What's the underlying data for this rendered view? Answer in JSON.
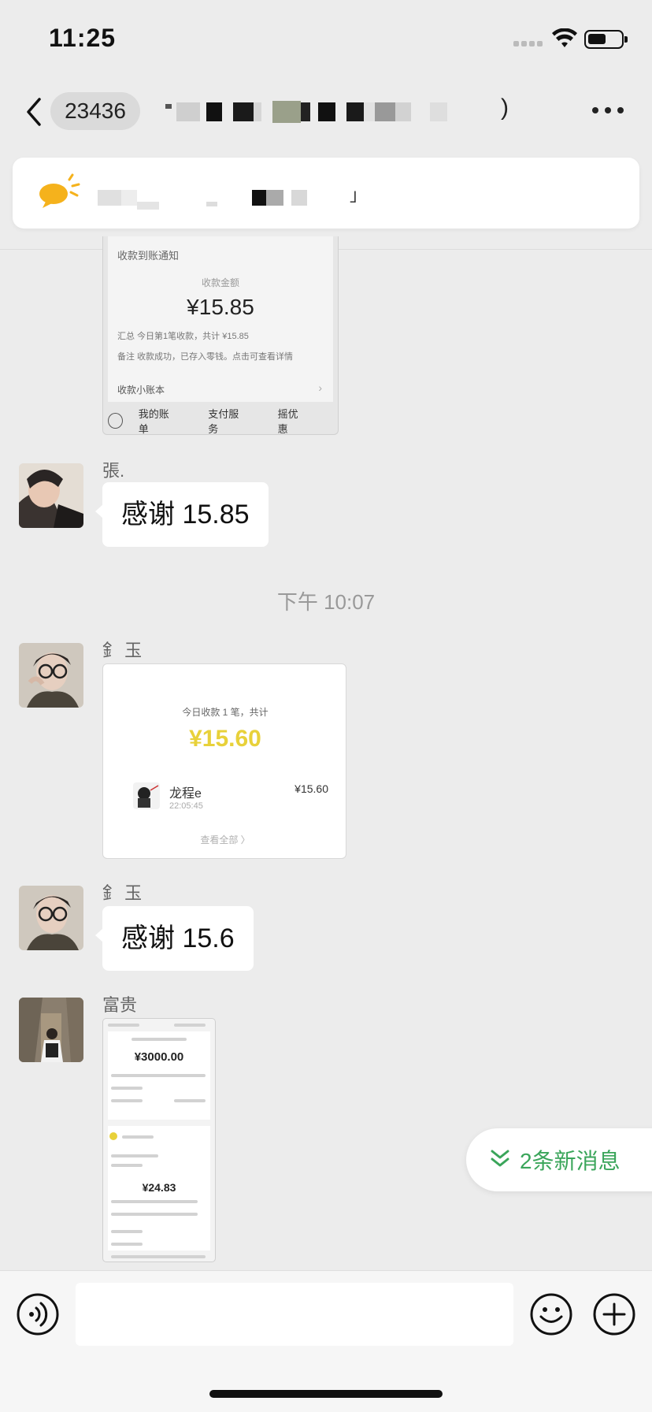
{
  "status_bar": {
    "time": "11:25"
  },
  "nav": {
    "unread_count": "23436",
    "title_tail": ")"
  },
  "notice": {
    "tail": "」"
  },
  "messages": {
    "receipt1": {
      "header": "收款到账通知",
      "amount_label": "收款金额",
      "amount": "¥15.85",
      "summary": "汇总   今日第1笔收款，共计 ¥15.85",
      "remark": "备注   收款成功，已存入零钱。点击可查看详情",
      "ledger": "收款小账本",
      "menu": [
        "我的账单",
        "支付服务",
        "摇优惠"
      ]
    },
    "msg1": {
      "sender": "張.",
      "text": "感谢 15.85"
    },
    "timestamp": "下午 10:07",
    "receipt2": {
      "sender": "釒 玉",
      "header": "今日收款 1 笔，共计",
      "total": "¥15.60",
      "payer_name": "龙程e",
      "payer_time": "22:05:45",
      "payer_amount": "¥15.60",
      "view_all": "查看全部 〉"
    },
    "msg2": {
      "sender": "釒 玉",
      "text": "感谢 15.6"
    },
    "shot": {
      "sender": "富贵",
      "amount1": "¥3000.00",
      "amount2": "¥24.83"
    }
  },
  "new_messages": {
    "label": "2条新消息"
  },
  "colors": {
    "accent_green": "#3aa55a",
    "receipt_yellow": "#e8d13a",
    "chat_bg": "#ececec"
  }
}
